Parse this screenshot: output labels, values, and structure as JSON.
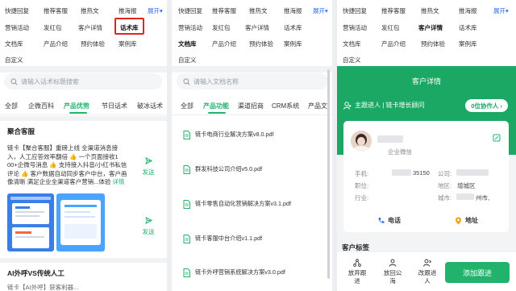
{
  "colors": {
    "accent": "#21b26c",
    "expand": "#2d6cf0",
    "highlight": "#e0261c"
  },
  "shortcuts": {
    "row1": [
      "快捷回复",
      "推荐客服",
      "推热文",
      "推海报"
    ],
    "row2": [
      "营销活动",
      "发红包",
      "客户详情",
      "话术库"
    ],
    "row3": [
      "文档库",
      "产品介绍",
      "预约体验",
      "案例库"
    ],
    "row4": [
      "自定义"
    ],
    "expand": "展开"
  },
  "panel1": {
    "search_placeholder": "请输入话术标题搜索",
    "tabs": [
      "全部",
      "企微百科",
      "产品优势",
      "节日话术",
      "破冰话术"
    ],
    "section1_title": "聚合客服",
    "desc_lines": [
      "链卡【聚合客服】重磅上线 全渠道消息接",
      "入，人工应答效率翻倍 👍 一个页面接收1",
      "00+企微号消息 👍 支持接入抖音/小红书私信",
      "评论 👍 客户数据自动同步客户中台，客户画",
      "像清晰 满足企业全渠道客户营销"
    ],
    "desc_more": "...体验",
    "desc_detail": "详情",
    "send_label": "发送",
    "section2_title": "AI外呼VS传统人工",
    "bottom_snippet": "链卡【AI外呼】获客利器..."
  },
  "panel2": {
    "search_placeholder": "请输入文档名称",
    "tabs": [
      "全部",
      "产品功能",
      "渠道招商",
      "CRM系统",
      "产品文"
    ],
    "send_label": "发送",
    "files": [
      "链卡电商行业解决方案v8.0.pdf",
      "群发科技公司介绍v5.0.pdf",
      "链卡零售自动化营销解决方案v3.1.pdf",
      "链卡客服中台介绍v1.1.pdf",
      "链卡外呼营销系统解决方案v3.0.pdf"
    ]
  },
  "panel3": {
    "title": "客户详情",
    "owner": "主跟进人 | 链卡增长顾问",
    "collab_button": "0位协作人 ›",
    "source": "企业微信",
    "fields": {
      "phone_label": "手机:",
      "phone_tail": "35150",
      "company_label": "公司:",
      "position_label": "职位:",
      "region_label": "地区:",
      "region_value": "增城区",
      "industry_label": "行业:",
      "city_label": "城市:",
      "city_value": "州市,"
    },
    "actions": {
      "phone": "电话",
      "address": "地址"
    },
    "tags_title": "客户标签",
    "bottom": {
      "release": [
        "放弃跟",
        "进"
      ],
      "return_pool": [
        "放回公",
        "海"
      ],
      "change_owner": [
        "改跟进",
        "人"
      ],
      "add_follow": "添加跟进"
    }
  }
}
